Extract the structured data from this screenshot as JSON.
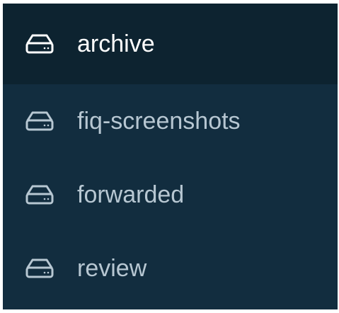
{
  "sidebar": {
    "items": [
      {
        "label": "archive",
        "icon": "drive-icon",
        "active": true
      },
      {
        "label": "fiq-screenshots",
        "icon": "drive-icon",
        "active": false
      },
      {
        "label": "forwarded",
        "icon": "drive-icon",
        "active": false
      },
      {
        "label": "review",
        "icon": "drive-icon",
        "active": false
      }
    ]
  },
  "colors": {
    "background": "#122d3f",
    "active_background": "#0d2330",
    "active_text": "#ffffff",
    "inactive_text": "#b7c7d2"
  }
}
